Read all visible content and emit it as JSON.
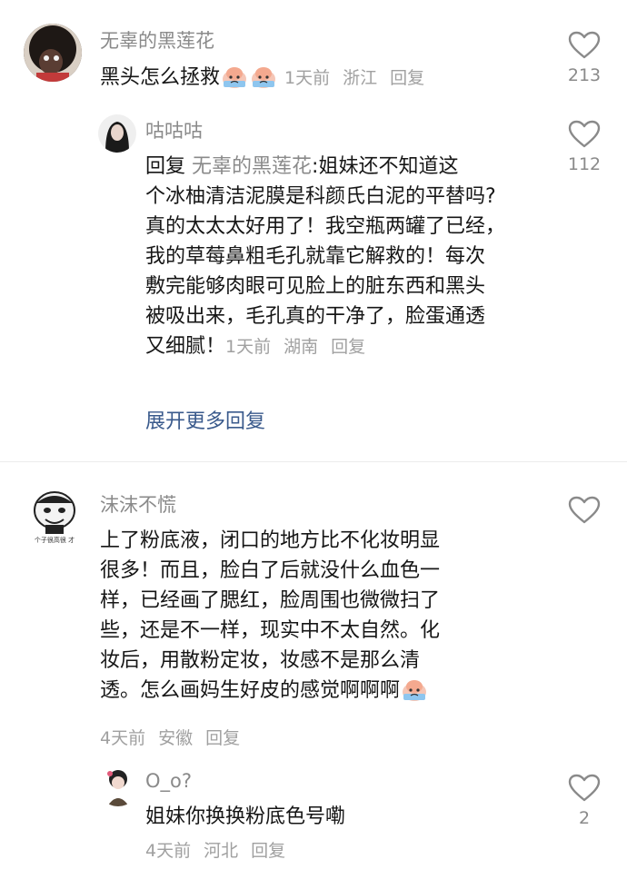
{
  "comments": [
    {
      "username": "无辜的黑莲花",
      "text": "黑头怎么拯救",
      "time": "1天前",
      "location": "浙江",
      "reply_label": "回复",
      "likes": "213"
    },
    {
      "username": "咕咕咕",
      "reply_prefix": "回复",
      "reply_to": "无辜的黑莲花",
      "text_lines": [
        ":姐妹还不知道这",
        "个冰柚清洁泥膜是科颜氏白泥的平替吗?",
        "真的太太太好用了！我空瓶两罐了已经，",
        "我的草莓鼻粗毛孔就靠它解救的！每次",
        "敷完能够肉眼可见脸上的脏东西和黑头",
        "被吸出来，毛孔真的干净了，脸蛋通透",
        "又细腻！"
      ],
      "time": "1天前",
      "location": "湖南",
      "reply_label": "回复",
      "likes": "112"
    },
    {
      "expand_label": "展开更多回复"
    },
    {
      "username": "沫沫不慌",
      "avatar_caption": "个子很高很 才",
      "text_lines": [
        "上了粉底液，闭口的地方比不化妆明显",
        "很多！而且，脸白了后就没什么血色一",
        "样，已经画了腮红，脸周围也微微扫了",
        "些，还是不一样，现实中不太自然。化",
        "妆后，用散粉定妆，妆感不是那么清",
        "透。怎么画妈生好皮的感觉啊啊啊"
      ],
      "time": "4天前",
      "location": "安徽",
      "reply_label": "回复",
      "likes": ""
    },
    {
      "username": "O_o?",
      "text": "姐妹你换换粉底色号嘞",
      "time": "4天前",
      "location": "河北",
      "reply_label": "回复",
      "likes": "2"
    }
  ],
  "icons": {
    "like": "heart-outline-icon",
    "emoji": "crying-face-emoji"
  },
  "colors": {
    "username": "#8a8a8a",
    "body_text": "#161616",
    "meta": "#a0a0a0",
    "link": "#3a5a8c",
    "divider": "#ececec"
  }
}
